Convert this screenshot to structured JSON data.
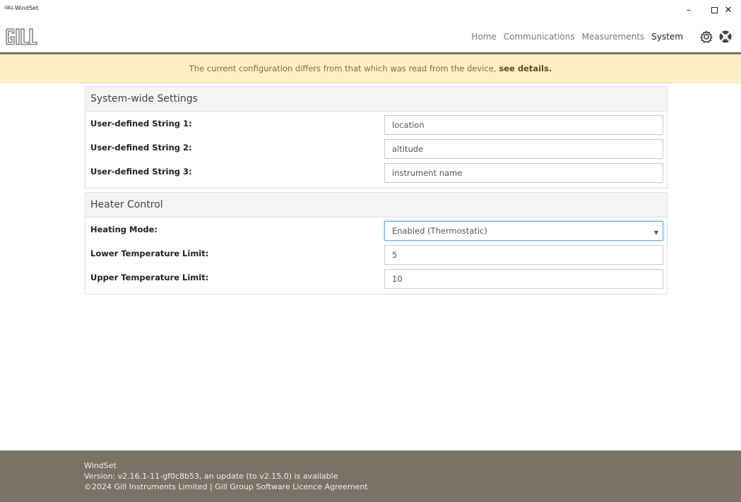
{
  "window": {
    "title": "WindSet",
    "icon_text": "GILL",
    "minimize": "–",
    "close": "✕"
  },
  "nav": {
    "logo": "GILL",
    "items": [
      {
        "label": "Home"
      },
      {
        "label": "Communications"
      },
      {
        "label": "Measurements"
      },
      {
        "label": "System"
      }
    ],
    "active": "System",
    "icons": [
      "gear-icon",
      "help-lifebuoy-icon"
    ]
  },
  "alert": {
    "message": "The current configuration differs from that which was read from the device,",
    "link": "see details."
  },
  "system_settings": {
    "title": "System-wide Settings",
    "rows": [
      {
        "label": "User-defined String 1:",
        "value": "location"
      },
      {
        "label": "User-defined String 2:",
        "value": "altitude"
      },
      {
        "label": "User-defined String 3:",
        "value": "instrument name"
      }
    ]
  },
  "heater": {
    "title": "Heater Control",
    "mode_label": "Heating Mode:",
    "mode_value": "Enabled (Thermostatic)",
    "lower_label": "Lower Temperature Limit:",
    "lower_value": "5",
    "upper_label": "Upper Temperature Limit:",
    "upper_value": "10"
  },
  "footer": {
    "app": "WindSet",
    "version": "Version: v2.16.1-11-gf0c8b53, an update (to v2.15.0) is available",
    "copyright": "©2024 Gill Instruments Limited | Gill Group Software Licence Agreement"
  },
  "colors": {
    "accent_bar": "#7a7267",
    "alert_bg": "#fcf0c4",
    "alert_text": "#8a6d3b",
    "focus": "#66afe9"
  }
}
